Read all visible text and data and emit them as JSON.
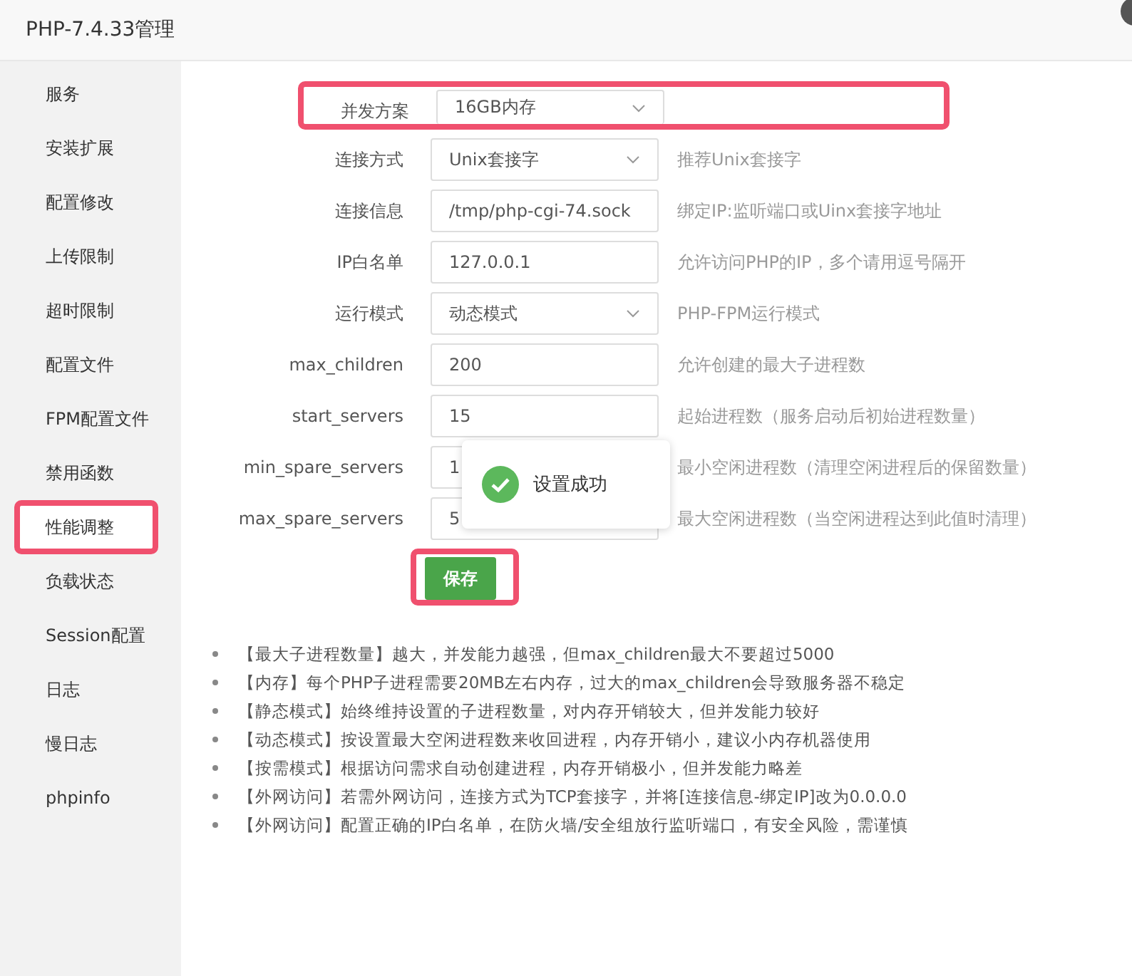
{
  "window": {
    "title": "PHP-7.4.33管理"
  },
  "sidebar": {
    "items": [
      {
        "label": "服务",
        "selected": false,
        "highlighted": false
      },
      {
        "label": "安装扩展",
        "selected": false,
        "highlighted": false
      },
      {
        "label": "配置修改",
        "selected": false,
        "highlighted": false
      },
      {
        "label": "上传限制",
        "selected": false,
        "highlighted": false
      },
      {
        "label": "超时限制",
        "selected": false,
        "highlighted": false
      },
      {
        "label": "配置文件",
        "selected": false,
        "highlighted": false
      },
      {
        "label": "FPM配置文件",
        "selected": false,
        "highlighted": false
      },
      {
        "label": "禁用函数",
        "selected": false,
        "highlighted": false
      },
      {
        "label": "性能调整",
        "selected": true,
        "highlighted": true
      },
      {
        "label": "负载状态",
        "selected": false,
        "highlighted": false
      },
      {
        "label": "Session配置",
        "selected": false,
        "highlighted": false
      },
      {
        "label": "日志",
        "selected": false,
        "highlighted": false
      },
      {
        "label": "慢日志",
        "selected": false,
        "highlighted": false
      },
      {
        "label": "phpinfo",
        "selected": false,
        "highlighted": false
      }
    ]
  },
  "form": {
    "rows": [
      {
        "label": "并发方案",
        "kind": "select",
        "value": "16GB内存",
        "hint": "",
        "highlighted": true
      },
      {
        "label": "连接方式",
        "kind": "select",
        "value": "Unix套接字",
        "hint": "推荐Unix套接字",
        "highlighted": false
      },
      {
        "label": "连接信息",
        "kind": "input",
        "value": "/tmp/php-cgi-74.sock",
        "hint": "绑定IP:监听端口或Uinx套接字地址",
        "highlighted": false
      },
      {
        "label": "IP白名单",
        "kind": "input",
        "value": "127.0.0.1",
        "hint": "允许访问PHP的IP，多个请用逗号隔开",
        "highlighted": false
      },
      {
        "label": "运行模式",
        "kind": "select",
        "value": "动态模式",
        "hint": "PHP-FPM运行模式",
        "highlighted": false
      },
      {
        "label": "max_children",
        "kind": "input",
        "value": "200",
        "hint": "允许创建的最大子进程数",
        "highlighted": false
      },
      {
        "label": "start_servers",
        "kind": "input",
        "value": "15",
        "hint": "起始进程数（服务启动后初始进程数量）",
        "highlighted": false
      },
      {
        "label": "min_spare_servers",
        "kind": "input",
        "value": "1",
        "hint": "最小空闲进程数（清理空闲进程后的保留数量）",
        "highlighted": false
      },
      {
        "label": "max_spare_servers",
        "kind": "input",
        "value": "5",
        "hint": "最大空闲进程数（当空闲进程达到此值时清理）",
        "highlighted": false
      }
    ],
    "save_button": {
      "label": "保存",
      "highlighted": true
    }
  },
  "toast": {
    "message": "设置成功"
  },
  "notes": [
    "【最大子进程数量】越大，并发能力越强，但max_children最大不要超过5000",
    "【内存】每个PHP子进程需要20MB左右内存，过大的max_children会导致服务器不稳定",
    "【静态模式】始终维持设置的子进程数量，对内存开销较大，但并发能力较好",
    "【动态模式】按设置最大空闲进程数来收回进程，内存开销小，建议小内存机器使用",
    "【按需模式】根据访问需求自动创建进程，内存开销极小，但并发能力略差",
    "【外网访问】若需外网访问，连接方式为TCP套接字，并将[连接信息-绑定IP]改为0.0.0.0",
    "【外网访问】配置正确的IP白名单，在防火墙/安全组放行监听端口，有安全风险，需谨慎"
  ]
}
